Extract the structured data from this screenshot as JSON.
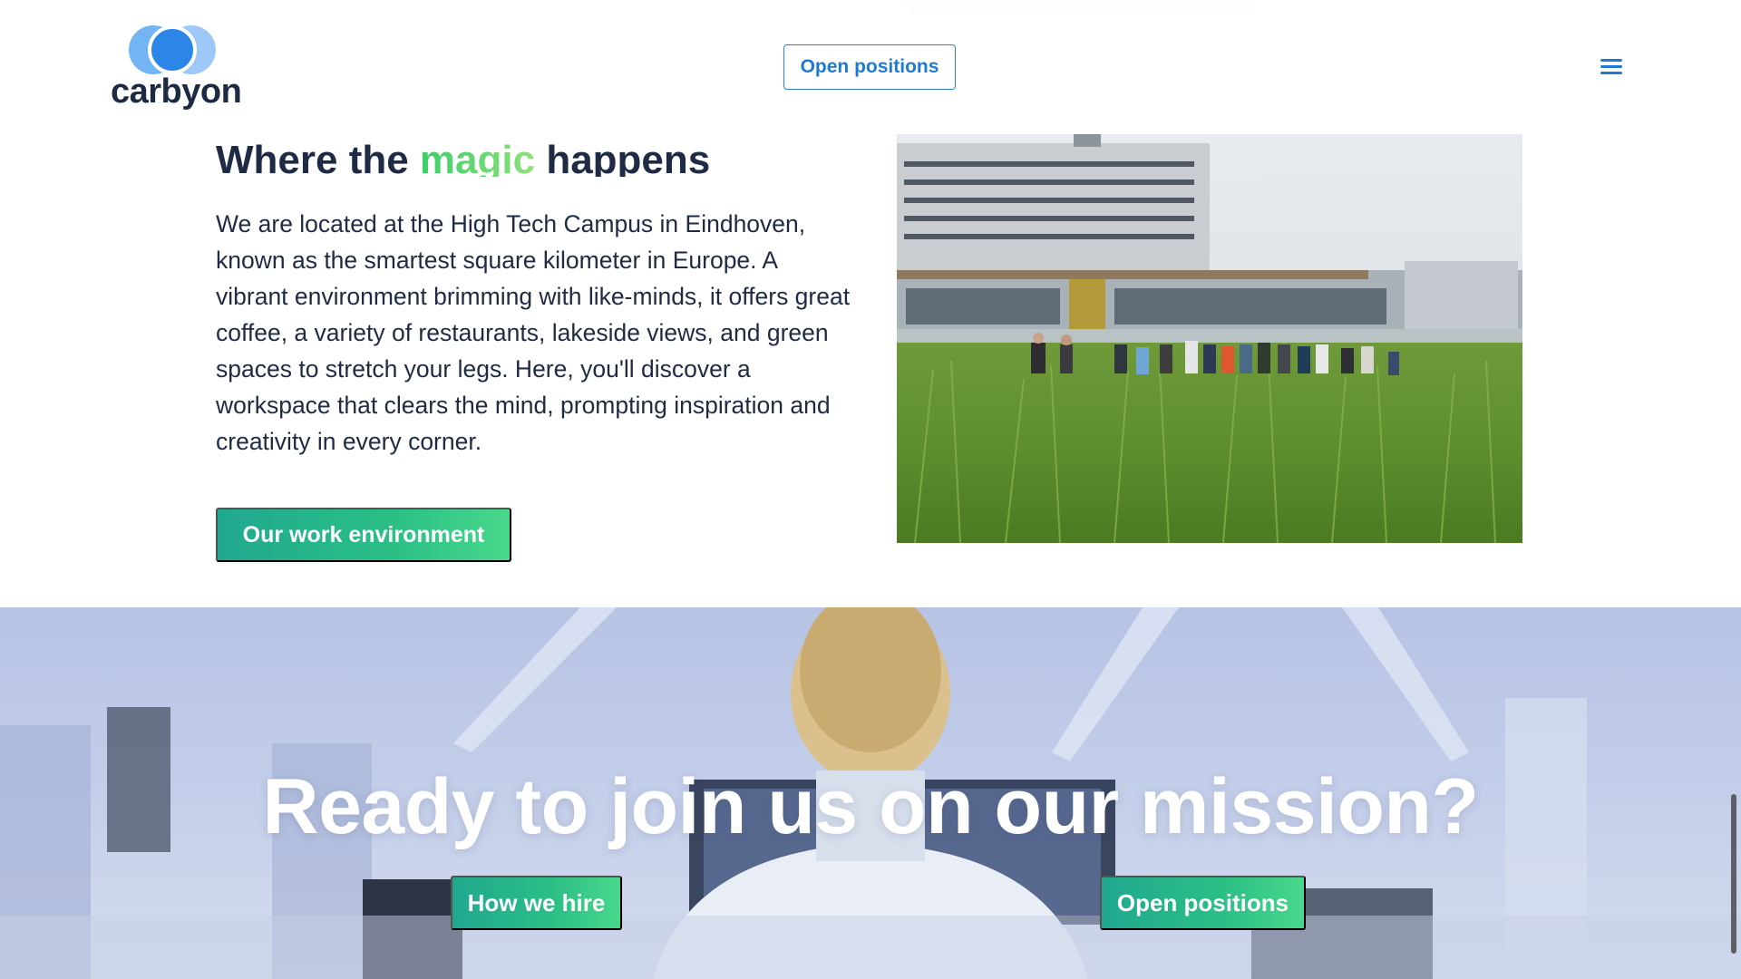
{
  "brand": {
    "name": "carbyon",
    "logo_icon": "three-overlapping-circles-logo",
    "primary_color": "#1f7ad6",
    "accent_gradient": [
      "#20a88f",
      "#48d88b"
    ],
    "text_color": "#1f2a44"
  },
  "header": {
    "cta_label": "Open positions",
    "menu_icon": "hamburger-menu-icon"
  },
  "location_section": {
    "heading_prefix": "Where the ",
    "heading_highlight": "magic",
    "heading_suffix": " happens",
    "body": "We are located at the High Tech Campus in Eindhoven, known as the smartest square kilometer in Europe. A vibrant environment brimming with like-minds, it offers great coffee, a variety of restaurants, lakeside views, and green spaces to stretch your legs. Here, you'll discover a workspace that clears the mind, prompting inspiration and creativity in every corner.",
    "button_label": "Our work environment"
  },
  "cta_banner": {
    "title": "Ready to join us on our mission?",
    "buttons": {
      "how_we_hire": "How we hire",
      "open_positions": "Open positions"
    }
  }
}
